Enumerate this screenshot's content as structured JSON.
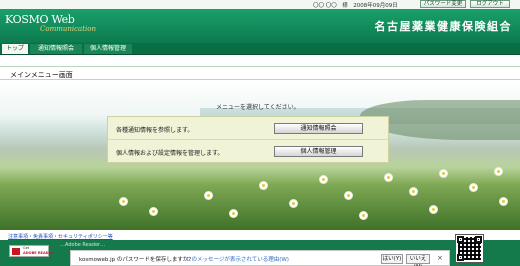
{
  "topbar": {
    "user_info": "〇〇 〇〇　様　2008年09月09日",
    "password_change_label": "パスワード変更",
    "logout_label": "ログアウト"
  },
  "header": {
    "logo": "KOSMO Web",
    "logo_sub": "Communication",
    "org_name": "名古屋薬業健康保険組合"
  },
  "nav": {
    "tabs": [
      {
        "label": "トップ",
        "active": true
      },
      {
        "label": "通知情報照会",
        "active": false
      },
      {
        "label": "個人情報管理",
        "active": false
      }
    ]
  },
  "page": {
    "title": "メインメニュー画面",
    "instruction": "メニューを選択してください。",
    "menu": [
      {
        "description": "各種通知情報を参照します。",
        "button": "通知情報照会"
      },
      {
        "description": "個人情報および設定情報を管理します。",
        "button": "個人情報管理"
      }
    ]
  },
  "footer": {
    "link": "注意事項・免責事項・セキュリティポリシー等",
    "note": "…Adobe Reader…",
    "reader_line1": "Get",
    "reader_line2": "ADOBE READER"
  },
  "notification": {
    "message": "kosmoweb.jp のパスワードを保存しますか?",
    "link": "このメッセージが表示されている理由(W)",
    "yes_label": "はい(Y)",
    "no_label": "いいえ(N)",
    "close_symbol": "×"
  },
  "colors": {
    "header_green": "#0d7a4e",
    "nav_green": "#0a6e44",
    "footer_green": "#147a4b",
    "panel_bg": "#f1f3d6"
  }
}
